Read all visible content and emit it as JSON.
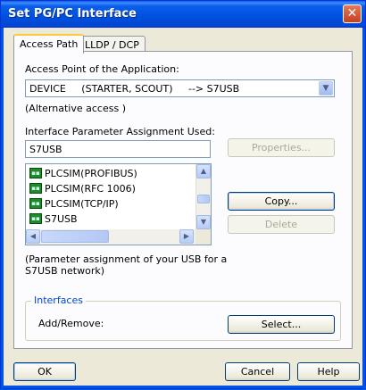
{
  "window": {
    "title": "Set PG/PC Interface",
    "close_glyph": "✕"
  },
  "tabs": [
    {
      "label": "Access Path",
      "active": true
    },
    {
      "label": "LLDP / DCP",
      "active": false
    }
  ],
  "access_point": {
    "label": "Access Point of the Application:",
    "value": "DEVICE     (STARTER, SCOUT)     --> S7USB",
    "note": "(Alternative access )"
  },
  "interface_param": {
    "label": "Interface Parameter Assignment Used:",
    "value": "S7USB",
    "list_items": [
      {
        "label": "PLCSIM(PROFIBUS)",
        "icon": "network-adapter-icon",
        "selected": false
      },
      {
        "label": "PLCSIM(RFC 1006)",
        "icon": "network-adapter-icon",
        "selected": false
      },
      {
        "label": "PLCSIM(TCP/IP)",
        "icon": "network-adapter-icon",
        "selected": false
      },
      {
        "label": "S7USB",
        "icon": "network-adapter-icon",
        "selected": true
      }
    ],
    "description": "(Parameter assignment of your USB for a S7USB network)",
    "description_line1": "(Parameter assignment of your USB for a",
    "description_line2": "S7USB network)"
  },
  "buttons": {
    "properties": "Properties...",
    "copy": "Copy...",
    "delete": "Delete",
    "select": "Select...",
    "ok": "OK",
    "cancel": "Cancel",
    "help": "Help"
  },
  "interfaces": {
    "group_title": "Interfaces",
    "add_remove_label": "Add/Remove:"
  },
  "icons": {
    "scroll_up": "▲",
    "scroll_down": "▼",
    "scroll_left": "◀",
    "scroll_right": "▶",
    "combo_arrow": "▼"
  },
  "colors": {
    "titlebar": "#0054e3",
    "dialog_bg": "#ece9d8",
    "panel_bg": "#fcfcfe",
    "group_title": "#0046d5"
  }
}
